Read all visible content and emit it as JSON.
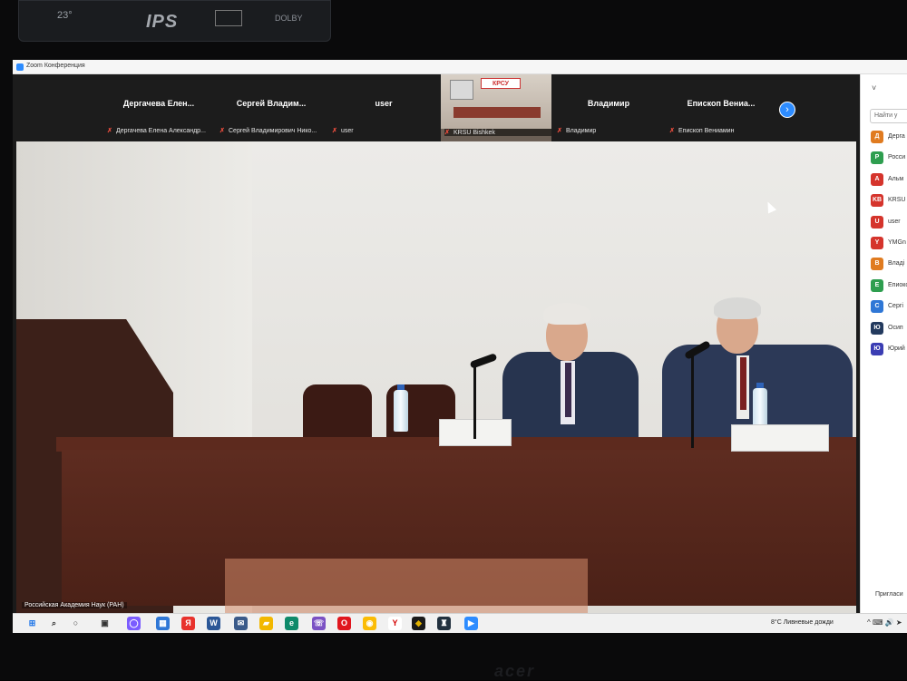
{
  "monitor": {
    "temperature": "23°",
    "badge_text": "IPS",
    "dolby_text": "DOLBY",
    "brand": "acer"
  },
  "zoom": {
    "window_title": "Zoom Конференция",
    "thumbnails": [
      {
        "name": "Дергачева Елен...",
        "sub": "Дергачева Елена Александр..."
      },
      {
        "name": "Сергей Владим...",
        "sub": "Сергей Владимирович Нико..."
      },
      {
        "name": "user",
        "sub": "user"
      },
      {
        "name": "",
        "sub": "KRSU Bishkek",
        "banner": "КРСУ"
      },
      {
        "name": "Владимир",
        "sub": "Владимир"
      },
      {
        "name": "Епископ Вениа...",
        "sub": "Епископ Вениамин"
      }
    ],
    "next_icon": "chevron-right-icon",
    "speaker_label": "Российская Академия Наук (РАН)"
  },
  "panel": {
    "search_placeholder": "Найти у",
    "participants": [
      {
        "initials": "Д",
        "name": "Дерга",
        "color": "#e07b20"
      },
      {
        "initials": "Р",
        "name": "Росси",
        "color": "#2e9e4f"
      },
      {
        "initials": "А",
        "name": "Альм",
        "color": "#d5342c"
      },
      {
        "initials": "KB",
        "name": "KRSU",
        "color": "#d5342c"
      },
      {
        "initials": "U",
        "name": "user",
        "color": "#d5342c"
      },
      {
        "initials": "Y",
        "name": "YMGn",
        "color": "#d5342c"
      },
      {
        "initials": "В",
        "name": "Владі",
        "color": "#e07b20"
      },
      {
        "initials": "Е",
        "name": "Епиоко",
        "color": "#2e9e4f"
      },
      {
        "initials": "С",
        "name": "Сергі",
        "color": "#2f77d6"
      },
      {
        "initials": "Ю",
        "name": "Осип",
        "color": "#233a5e"
      },
      {
        "initials": "Ю",
        "name": "Юрий",
        "color": "#3b3db3"
      }
    ],
    "invite_label": "Пригласи"
  },
  "taskbar": {
    "weather": "8°C Ливневые дожди",
    "tray": "^ ⌨ 🔊 ➤"
  }
}
